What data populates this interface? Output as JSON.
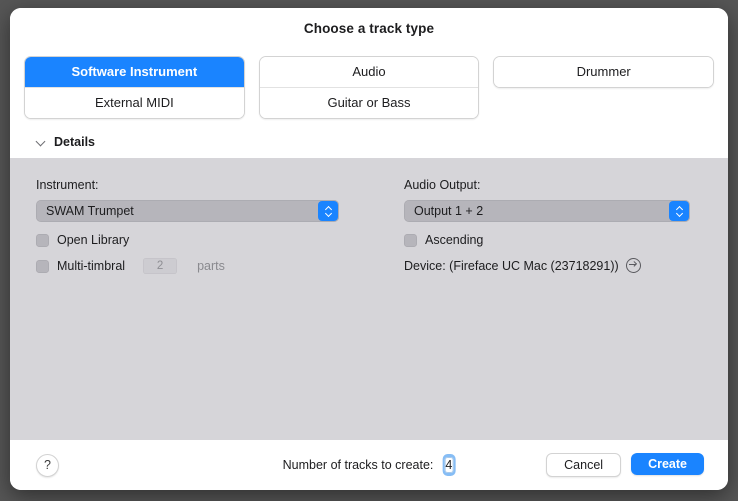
{
  "dialog": {
    "title": "Choose a track type"
  },
  "track_types": {
    "groups": [
      {
        "options": [
          {
            "label": "Software Instrument",
            "selected": true
          },
          {
            "label": "External MIDI",
            "selected": false
          }
        ]
      },
      {
        "options": [
          {
            "label": "Audio",
            "selected": false
          },
          {
            "label": "Guitar or Bass",
            "selected": false
          }
        ]
      },
      {
        "options": [
          {
            "label": "Drummer",
            "selected": false
          }
        ]
      }
    ]
  },
  "details": {
    "header_label": "Details",
    "chevron_icon": "chevron-down-icon",
    "instrument": {
      "label": "Instrument:",
      "value": "SWAM Trumpet",
      "stepper_icon": "up-down-chevron-icon"
    },
    "open_library": {
      "label": "Open Library",
      "checked": false
    },
    "multi_timbral": {
      "label": "Multi-timbral",
      "checked": false,
      "parts_value": "2",
      "parts_label": "parts"
    },
    "audio_output": {
      "label": "Audio Output:",
      "value": "Output 1 + 2",
      "stepper_icon": "up-down-chevron-icon"
    },
    "ascending": {
      "label": "Ascending",
      "checked": false
    },
    "device": {
      "text": "Device: (Fireface UC Mac (23718291))",
      "open_icon": "arrow-right-circle-icon"
    }
  },
  "footer": {
    "help_label": "?",
    "help_icon": "question-mark-icon",
    "tracks_label": "Number of tracks to create:",
    "tracks_value": "4",
    "cancel_label": "Cancel",
    "create_label": "Create"
  },
  "colors": {
    "accent": "#1a84ff",
    "panel_bg": "#d6d5d9",
    "control_bg": "#b6b5bb",
    "backdrop": "#565656"
  }
}
